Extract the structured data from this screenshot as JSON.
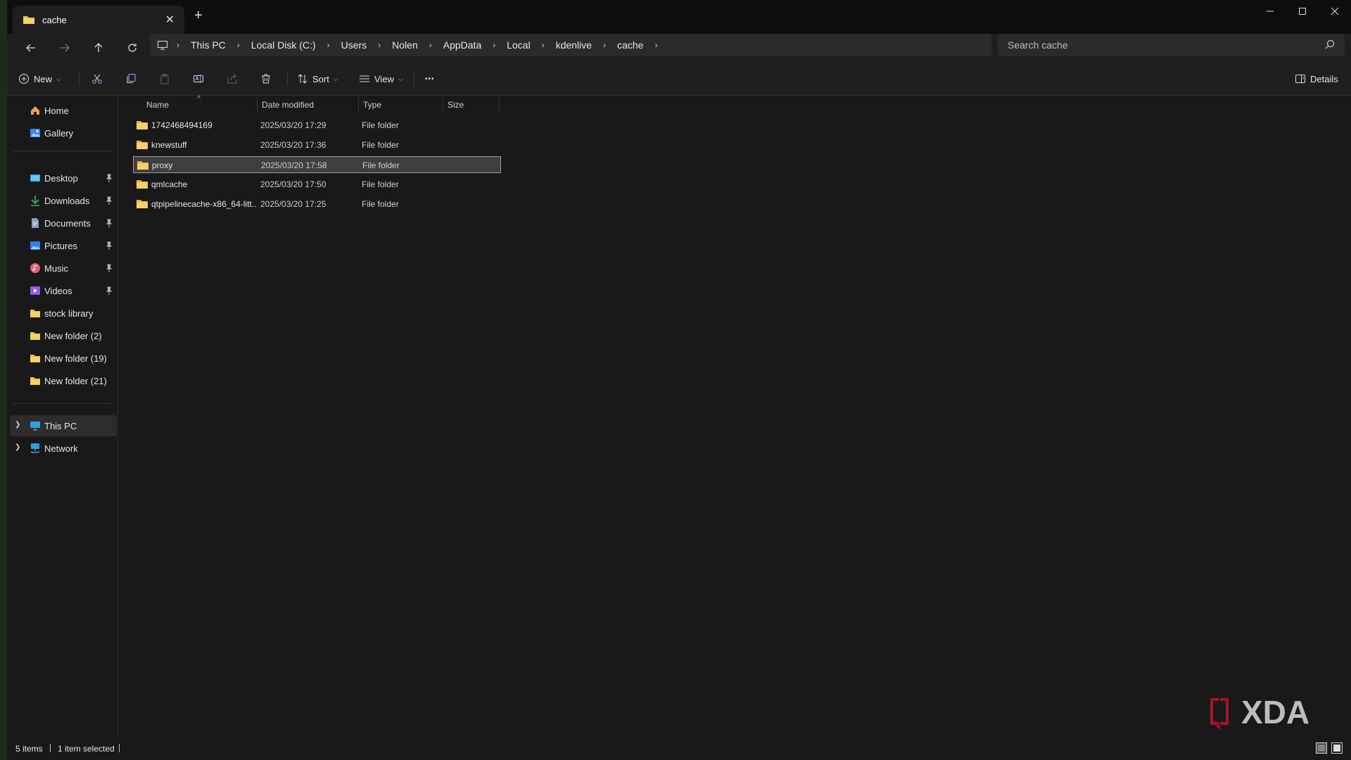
{
  "window": {
    "tab_title": "cache",
    "new_tab_symbol": "+"
  },
  "breadcrumb": [
    "This PC",
    "Local Disk (C:)",
    "Users",
    "Nolen",
    "AppData",
    "Local",
    "kdenlive",
    "cache"
  ],
  "search": {
    "placeholder": "Search cache"
  },
  "commands": {
    "new": "New",
    "sort": "Sort",
    "view": "View",
    "more": "•••",
    "details": "Details"
  },
  "sidebar": {
    "quick": [
      {
        "label": "Home",
        "icon": "home-icon"
      },
      {
        "label": "Gallery",
        "icon": "gallery-icon"
      }
    ],
    "pinned": [
      {
        "label": "Desktop",
        "icon": "desktop-icon",
        "pinned": true
      },
      {
        "label": "Downloads",
        "icon": "downloads-icon",
        "pinned": true
      },
      {
        "label": "Documents",
        "icon": "documents-icon",
        "pinned": true
      },
      {
        "label": "Pictures",
        "icon": "pictures-icon",
        "pinned": true
      },
      {
        "label": "Music",
        "icon": "music-icon",
        "pinned": true
      },
      {
        "label": "Videos",
        "icon": "videos-icon",
        "pinned": true
      },
      {
        "label": "stock library",
        "icon": "folder-icon",
        "pinned": false
      },
      {
        "label": "New folder (2)",
        "icon": "folder-icon",
        "pinned": false
      },
      {
        "label": "New folder (19)",
        "icon": "folder-icon",
        "pinned": false
      },
      {
        "label": "New folder (21)",
        "icon": "folder-icon",
        "pinned": false
      }
    ],
    "locations": [
      {
        "label": "This PC",
        "icon": "this-pc-icon",
        "selected": true
      },
      {
        "label": "Network",
        "icon": "network-icon",
        "selected": false
      }
    ]
  },
  "columns": [
    "Name",
    "Date modified",
    "Type",
    "Size"
  ],
  "files": [
    {
      "name": "1742468494169",
      "date": "2025/03/20 17:29",
      "type": "File folder",
      "selected": false
    },
    {
      "name": "knewstuff",
      "date": "2025/03/20 17:36",
      "type": "File folder",
      "selected": false
    },
    {
      "name": "proxy",
      "date": "2025/03/20 17:58",
      "type": "File folder",
      "selected": true
    },
    {
      "name": "qmlcache",
      "date": "2025/03/20 17:50",
      "type": "File folder",
      "selected": false
    },
    {
      "name": "qtpipelinecache-x86_64-litt...",
      "date": "2025/03/20 17:25",
      "type": "File folder",
      "selected": false
    }
  ],
  "status": {
    "items": "5 items",
    "selected": "1 item selected"
  },
  "watermark": {
    "text": "XDA"
  },
  "colors": {
    "folder": "#f2c14e",
    "selection": "#3f3f3f",
    "xda_red": "#c8102e"
  }
}
